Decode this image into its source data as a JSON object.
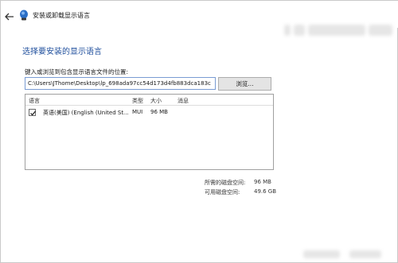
{
  "titlebar": {
    "title": "安装或卸载显示语言"
  },
  "heading": "选择要安装的显示语言",
  "path": {
    "label": "键入或浏览到包含显示语言文件的位置:",
    "value": "C:\\Users\\JThome\\Desktop\\lp_698ada97cc54d173d4fb883dca183c"
  },
  "browse_label": "浏览...",
  "list": {
    "columns": [
      "语言",
      "类型",
      "大小",
      "消息"
    ],
    "rows": [
      {
        "checked": true,
        "language": "英语(美国) (English (United St...",
        "type": "MUI",
        "size": "96 MB",
        "message": ""
      }
    ]
  },
  "space": {
    "required_label": "所需的磁盘空间:",
    "required_value": "96 MB",
    "available_label": "可用磁盘空间:",
    "available_value": "49.6 GB"
  },
  "colors": {
    "heading": "#1e4e9c",
    "input_border": "#7a9cd3",
    "button_bg": "#e4e4e4"
  },
  "icons": {
    "back": "back-arrow-icon",
    "app": "language-globe-icon",
    "check": "checkmark-icon"
  }
}
